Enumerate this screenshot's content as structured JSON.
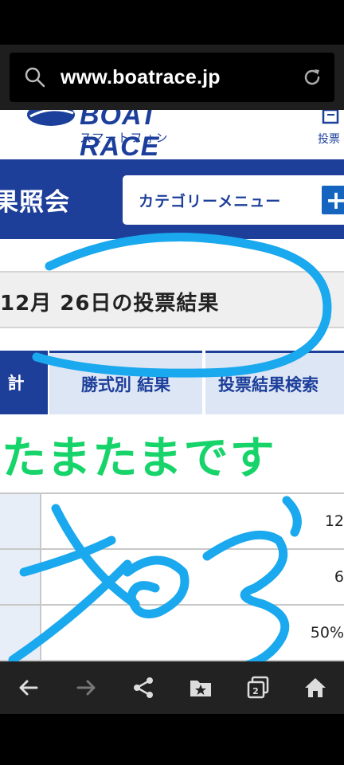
{
  "browser": {
    "url": "www.boatrace.jp",
    "tab_count": "2"
  },
  "site": {
    "logo_text": "BOAT RACE",
    "subtitle": "スマートフォン",
    "vote_link": "投票"
  },
  "page": {
    "title": "果照会",
    "category_menu_label": "カテゴリーメニュー",
    "date_heading": "12月 26日の投票結果",
    "tabs": [
      "計",
      "勝式別 結果",
      "投票結果検索"
    ],
    "overlay_text": "たまたまです"
  },
  "table": {
    "rows": [
      {
        "value": "12"
      },
      {
        "value": "6"
      },
      {
        "value": "50%"
      }
    ]
  },
  "colors": {
    "brand": "#1d3f9a",
    "overlay_green": "#17d46a",
    "scribble_blue": "#1aa8ee"
  }
}
